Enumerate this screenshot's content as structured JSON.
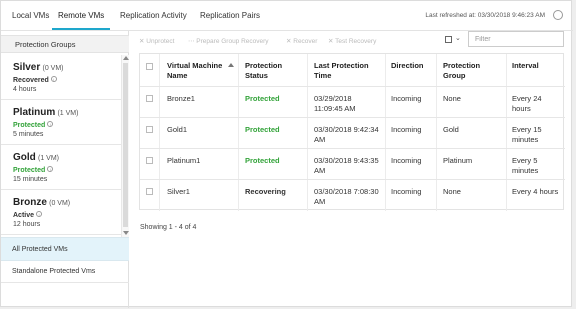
{
  "tabs": [
    {
      "label": "Local VMs"
    },
    {
      "label": "Remote VMs"
    },
    {
      "label": "Replication Activity"
    },
    {
      "label": "Replication Pairs"
    }
  ],
  "refresh": {
    "text": "Last refreshed at: 03/30/2018 9:46:23 AM"
  },
  "sidebar": {
    "header": "Protection Groups",
    "groups": [
      {
        "name": "Silver",
        "count": "(0 VM)",
        "status": "Recovered",
        "interval": "4 hours",
        "status_color": "#333333"
      },
      {
        "name": "Platinum",
        "count": "(1 VM)",
        "status": "Protected",
        "interval": "5 minutes",
        "status_color": "#33a33a"
      },
      {
        "name": "Gold",
        "count": "(1 VM)",
        "status": "Protected",
        "interval": "15 minutes",
        "status_color": "#33a33a"
      },
      {
        "name": "Bronze",
        "count": "(0 VM)",
        "status": "Active",
        "interval": "12 hours",
        "status_color": "#333333"
      }
    ],
    "all_vms": "All Protected VMs",
    "standalone": "Standalone Protected Vms"
  },
  "toolbar": {
    "unprotect": "✕ Unprotect",
    "prepare": "⋯ Prepare Group Recovery",
    "recover": "✕ Recover",
    "test": "✕ Test Recovery",
    "filter_placeholder": "Filter"
  },
  "table": {
    "headers": [
      "Virtual Machine Name",
      "Protection Status",
      "Last Protection Time",
      "Direction",
      "Protection Group",
      "Interval"
    ],
    "rows": [
      {
        "name": "Bronze1",
        "status": "Protected",
        "time": "03/29/2018 11:09:45 AM",
        "direction": "Incoming",
        "group": "None",
        "interval": "Every 24 hours"
      },
      {
        "name": "Gold1",
        "status": "Protected",
        "time": "03/30/2018 9:42:34 AM",
        "direction": "Incoming",
        "group": "Gold",
        "interval": "Every 15 minutes"
      },
      {
        "name": "Platinum1",
        "status": "Protected",
        "time": "03/30/2018 9:43:35 AM",
        "direction": "Incoming",
        "group": "Platinum",
        "interval": "Every 5 minutes"
      },
      {
        "name": "Silver1",
        "status": "Recovering",
        "time": "03/30/2018 7:08:30 AM",
        "direction": "Incoming",
        "group": "None",
        "interval": "Every 4 hours"
      }
    ],
    "footer": "Showing 1 - 4 of 4"
  },
  "colors": {
    "accent": "#1ea7cc",
    "protected": "#33a33a",
    "selected_bg": "#e3f3fa"
  }
}
